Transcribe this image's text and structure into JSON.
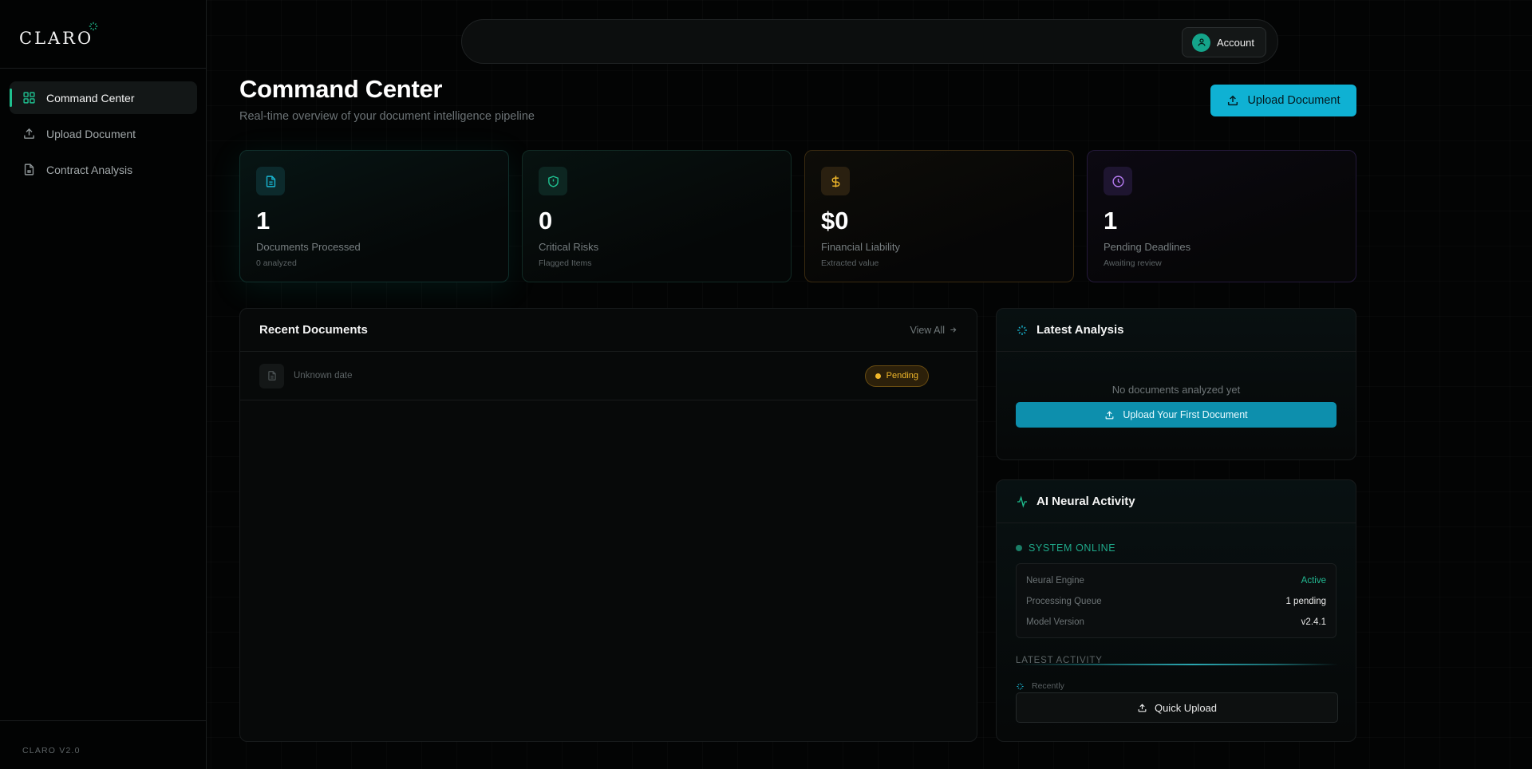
{
  "app": {
    "logo": "CLARO",
    "version": "CLARO V2.0"
  },
  "sidebar": {
    "items": [
      {
        "label": "Command Center",
        "icon": "grid-icon",
        "active": true
      },
      {
        "label": "Upload Document",
        "icon": "upload-icon"
      },
      {
        "label": "Contract Analysis",
        "icon": "file-icon"
      }
    ]
  },
  "topbar": {
    "account_label": "Account"
  },
  "header": {
    "title": "Command Center",
    "subtitle": "Real-time overview of your document intelligence pipeline",
    "upload_label": "Upload Document"
  },
  "stats": [
    {
      "value": "1",
      "label": "Documents Processed",
      "sub": "0 analyzed",
      "icon": "document-icon",
      "color": "#19b4d0"
    },
    {
      "value": "0",
      "label": "Critical Risks",
      "sub": "Flagged Items",
      "icon": "shield-icon",
      "color": "#1fbf8f"
    },
    {
      "value": "$0",
      "label": "Financial Liability",
      "sub": "Extracted value",
      "icon": "dollar-icon",
      "color": "#f0b72a"
    },
    {
      "value": "1",
      "label": "Pending Deadlines",
      "sub": "Awaiting review",
      "icon": "clock-icon",
      "color": "#b57bf0"
    }
  ],
  "recent": {
    "title": "Recent Documents",
    "view_all": "View All",
    "rows": [
      {
        "date": "Unknown date",
        "status": "Pending"
      }
    ]
  },
  "latest": {
    "title": "Latest Analysis",
    "empty": "No documents analyzed yet",
    "cta": "Upload Your First Document"
  },
  "neural": {
    "title": "AI Neural Activity",
    "status": "SYSTEM ONLINE",
    "rows": [
      {
        "label": "Neural Engine",
        "value": "Active"
      },
      {
        "label": "Processing Queue",
        "value": "1 pending"
      },
      {
        "label": "Model Version",
        "value": "v2.4.1"
      }
    ],
    "latest_label": "LATEST ACTIVITY",
    "activity": "Recently",
    "quick_upload": "Quick Upload"
  },
  "colors": {
    "accent": "#0fb1d3",
    "success": "#1fbf8f",
    "warning": "#f0b72a",
    "purple": "#b57bf0"
  }
}
